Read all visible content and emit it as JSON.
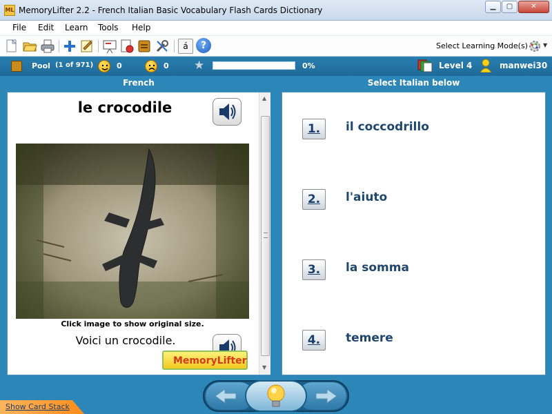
{
  "window": {
    "title": "MemoryLifter 2.2 - French Italian Basic Vocabulary Flash Cards Dictionary",
    "app_icon_text": "ML",
    "buttons": [
      "minimize",
      "maximize",
      "close"
    ]
  },
  "menu": [
    "File",
    "Edit",
    "Learn",
    "Tools",
    "Help"
  ],
  "toolbar": {
    "icons": [
      "new-icon",
      "open-icon",
      "print-icon",
      "add-icon",
      "edit-icon",
      "slideshow-icon",
      "media-icon",
      "print2-icon",
      "settings-icon",
      "character-icon",
      "help-icon"
    ],
    "character_label": "á",
    "help_label": "?",
    "mode_label": "Select Learning Mode(s)"
  },
  "status": {
    "pool_label": "Pool",
    "pool_count": "(1 of 971)",
    "happy_count": "0",
    "sad_count": "0",
    "progress_percent": 0,
    "progress_text": "0%",
    "level": "Level 4",
    "user": "manwei30"
  },
  "panels": {
    "left_header": "French",
    "right_header": "Select Italian below"
  },
  "card": {
    "word": "le crocodile",
    "image_caption": "Click image to show original size.",
    "sentence": "Voici un crocodile.",
    "logo_text": "MemoryLifter"
  },
  "answers": [
    {
      "number": "1.",
      "text": "il coccodrillo"
    },
    {
      "number": "2.",
      "text": "l'aiuto"
    },
    {
      "number": "3.",
      "text": "la somma"
    },
    {
      "number": "4.",
      "text": "temere"
    }
  ],
  "footer": {
    "show_card_stack": "Show Card Stack"
  },
  "colors": {
    "accent_blue": "#2d86b8",
    "answer_text": "#1e466f",
    "logo_red": "#d4391c"
  }
}
